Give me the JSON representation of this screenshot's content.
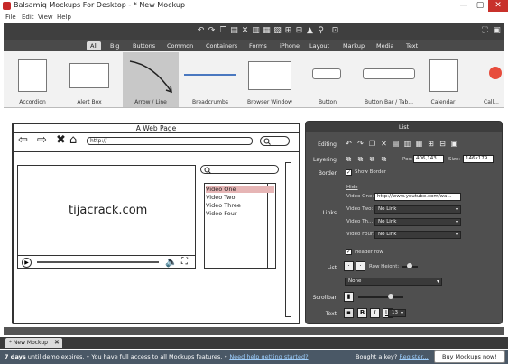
{
  "window": {
    "title": "Balsamiq Mockups For Desktop - * New Mockup",
    "min_glyph": "—",
    "max_glyph": "▢",
    "close_glyph": "✕"
  },
  "menu": [
    "File",
    "Edit",
    "View",
    "Help"
  ],
  "toolbar_icons": [
    "undo-icon",
    "redo-icon",
    "copy-icon",
    "paste-icon",
    "cut-icon",
    "delete-icon",
    "duplicate-icon",
    "lock-icon",
    "group-icon",
    "ungroup-icon",
    "bring-front-icon",
    "send-back-icon",
    "search-icon",
    "fullscreen-icon",
    "settings-icon"
  ],
  "categories": [
    "All",
    "Big",
    "Buttons",
    "Common",
    "Containers",
    "Forms",
    "iPhone",
    "Layout",
    "Markup",
    "Media",
    "Text"
  ],
  "active_category": "All",
  "library": [
    {
      "label": "Accordion"
    },
    {
      "label": "Alert Box"
    },
    {
      "label": "Arrow / Line"
    },
    {
      "label": "Breadcrumbs"
    },
    {
      "label": "Browser Window"
    },
    {
      "label": "Button"
    },
    {
      "label": "Button Bar / Tab..."
    },
    {
      "label": "Calendar"
    },
    {
      "label": "Call..."
    }
  ],
  "mockup": {
    "title": "A Web Page",
    "url": "http://",
    "videos": [
      "Video One",
      "Video Two",
      "Video Three",
      "Video Four"
    ],
    "selected_video": "Video One",
    "nav_back": "⇦",
    "nav_fwd": "⇨",
    "nav_close": "✖",
    "nav_home": "⌂"
  },
  "watermark": "tijacrack.com",
  "inspector": {
    "title": "List",
    "editing_label": "Editing",
    "layering_label": "Layering",
    "pos_label": "Pos:",
    "pos_value": "406,143",
    "size_label": "Size:",
    "size_value": "146x179",
    "border_label": "Border",
    "show_border": "Show Border",
    "hide_label": "Hide",
    "links_label": "Links",
    "video_one_label": "Video One:",
    "video_one_value": "http://www.youtube.com/wa...",
    "video_two_label": "Video Two:",
    "video_three_label": "Video Th...",
    "video_four_label": "Video Four:",
    "no_link": "No Link",
    "header_row": "Header row",
    "list_label": "List",
    "row_height": "Row Height:",
    "none_option": "None",
    "scrollbar_label": "Scrollbar",
    "text_label": "Text",
    "bold": "B",
    "italic": "I",
    "underline": "U",
    "font_size": "13"
  },
  "doc_tab": "* New Mockup",
  "status": {
    "days": "7 days",
    "message": "until demo expires.  •  You have full access to all Mockups features.  •",
    "help_link": "Need help getting started?",
    "bought": "Bought a key?",
    "register": "Register...",
    "buy_button": "Buy Mockups now!"
  }
}
